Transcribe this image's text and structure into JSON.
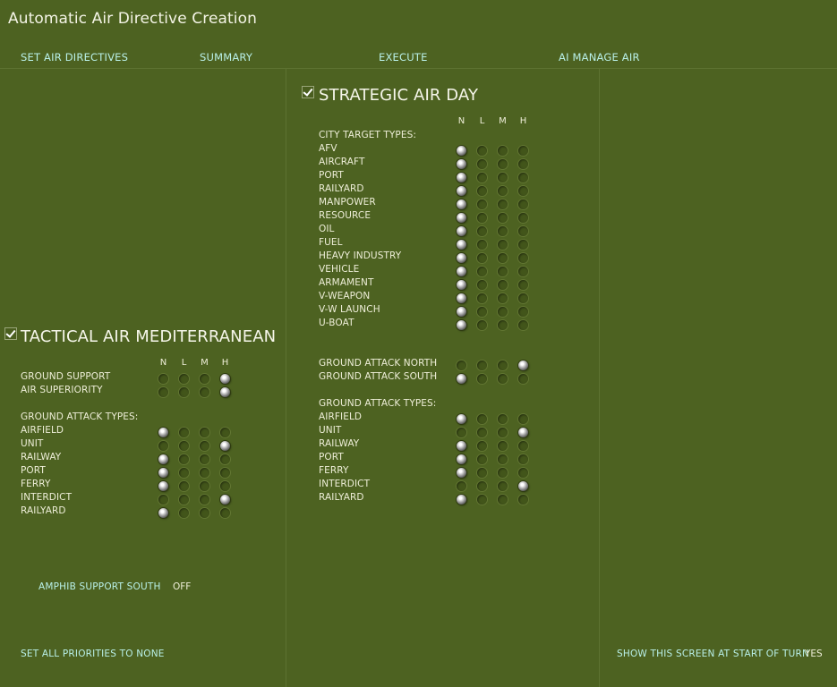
{
  "title": "Automatic Air Directive Creation",
  "tabs": [
    {
      "label": "SET AIR DIRECTIVES"
    },
    {
      "label": "SUMMARY"
    },
    {
      "label": "EXECUTE"
    },
    {
      "label": "AI MANAGE AIR"
    }
  ],
  "columns": [
    "N",
    "L",
    "M",
    "H"
  ],
  "colors": {
    "background": "#4d6221",
    "link": "#b9f0e8",
    "text": "#eeeed8"
  },
  "strategic": {
    "title": "STRATEGIC AIR DAY",
    "checked": true,
    "city_header": "CITY TARGET TYPES:",
    "city_rows": [
      {
        "label": "AFV",
        "selected": "N"
      },
      {
        "label": "AIRCRAFT",
        "selected": "N"
      },
      {
        "label": "PORT",
        "selected": "N"
      },
      {
        "label": "RAILYARD",
        "selected": "N"
      },
      {
        "label": "MANPOWER",
        "selected": "N"
      },
      {
        "label": "RESOURCE",
        "selected": "N"
      },
      {
        "label": "OIL",
        "selected": "N"
      },
      {
        "label": "FUEL",
        "selected": "N"
      },
      {
        "label": "HEAVY INDUSTRY",
        "selected": "N"
      },
      {
        "label": "VEHICLE",
        "selected": "N"
      },
      {
        "label": "ARMAMENT",
        "selected": "N"
      },
      {
        "label": "V-WEAPON",
        "selected": "N"
      },
      {
        "label": "V-W LAUNCH",
        "selected": "N"
      },
      {
        "label": "U-BOAT",
        "selected": "N"
      }
    ],
    "ground_rows": [
      {
        "label": "GROUND ATTACK NORTH",
        "selected": "H"
      },
      {
        "label": "GROUND ATTACK SOUTH",
        "selected": "N"
      }
    ],
    "ground_types_header": "GROUND ATTACK TYPES:",
    "ground_type_rows": [
      {
        "label": "AIRFIELD",
        "selected": "N"
      },
      {
        "label": "UNIT",
        "selected": "H"
      },
      {
        "label": "RAILWAY",
        "selected": "N"
      },
      {
        "label": "PORT",
        "selected": "N"
      },
      {
        "label": "FERRY",
        "selected": "N"
      },
      {
        "label": "INTERDICT",
        "selected": "H"
      },
      {
        "label": "RAILYARD",
        "selected": "N"
      }
    ]
  },
  "tactical": {
    "title": "TACTICAL AIR MEDITERRANEAN",
    "checked": true,
    "rows": [
      {
        "label": "GROUND SUPPORT",
        "selected": "H"
      },
      {
        "label": "AIR SUPERIORITY",
        "selected": "H"
      }
    ],
    "types_header": "GROUND ATTACK TYPES:",
    "type_rows": [
      {
        "label": "AIRFIELD",
        "selected": "N"
      },
      {
        "label": "UNIT",
        "selected": "H"
      },
      {
        "label": "RAILWAY",
        "selected": "N"
      },
      {
        "label": "PORT",
        "selected": "N"
      },
      {
        "label": "FERRY",
        "selected": "N"
      },
      {
        "label": "INTERDICT",
        "selected": "H"
      },
      {
        "label": "RAILYARD",
        "selected": "N"
      }
    ]
  },
  "amphib": {
    "label": "AMPHIB SUPPORT SOUTH",
    "value": "OFF"
  },
  "footer": {
    "set_all_label": "SET ALL PRIORITIES TO NONE",
    "show_screen_label": "SHOW THIS SCREEN AT START OF TURN",
    "show_screen_value": "YES"
  }
}
